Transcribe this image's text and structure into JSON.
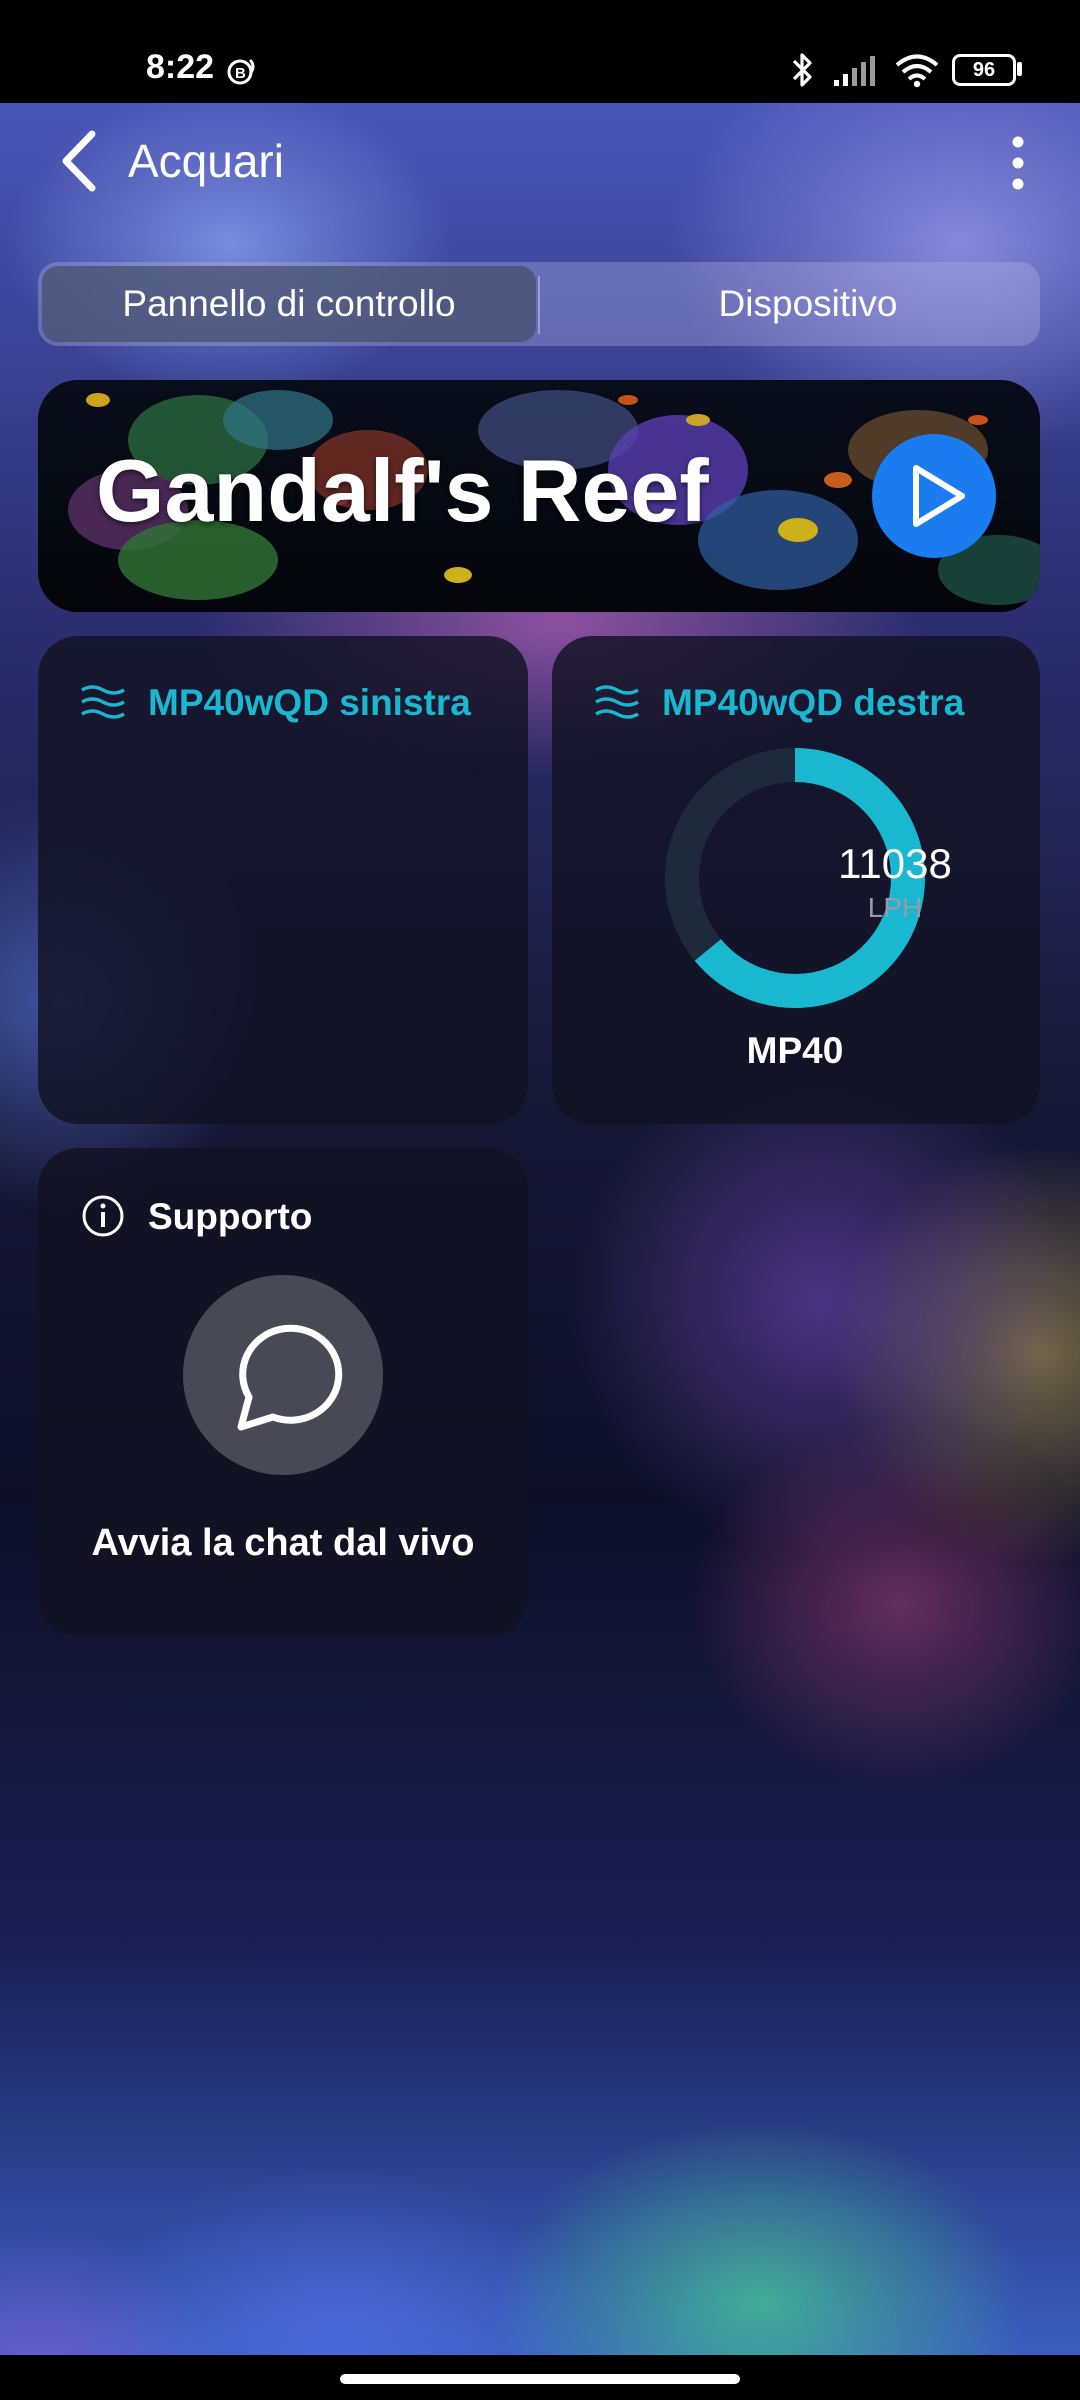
{
  "status_bar": {
    "time": "8:22",
    "battery": "96"
  },
  "app_bar": {
    "title": "Acquari",
    "back_icon": "chevron-left-icon",
    "menu_icon": "more-vert-icon"
  },
  "tabs": [
    {
      "label": "Pannello di controllo",
      "selected": true
    },
    {
      "label": "Dispositivo",
      "selected": false
    }
  ],
  "banner": {
    "title": "Gandalf's Reef",
    "play_icon": "play-icon"
  },
  "pumps": [
    {
      "name": "MP40wQD sinistra",
      "icon": "waves-icon"
    },
    {
      "name": "MP40wQD destra",
      "icon": "waves-icon",
      "flow_value": "11038",
      "flow_unit": "LPH",
      "model": "MP40",
      "gauge_fraction": 0.64
    }
  ],
  "support": {
    "title": "Supporto",
    "icon": "info-icon",
    "chat_label": "Avvia la chat dal vivo",
    "chat_icon": "chat-bubble-icon"
  },
  "colors": {
    "accent_teal": "#19b7d0",
    "play_blue": "#1a7cf0"
  }
}
